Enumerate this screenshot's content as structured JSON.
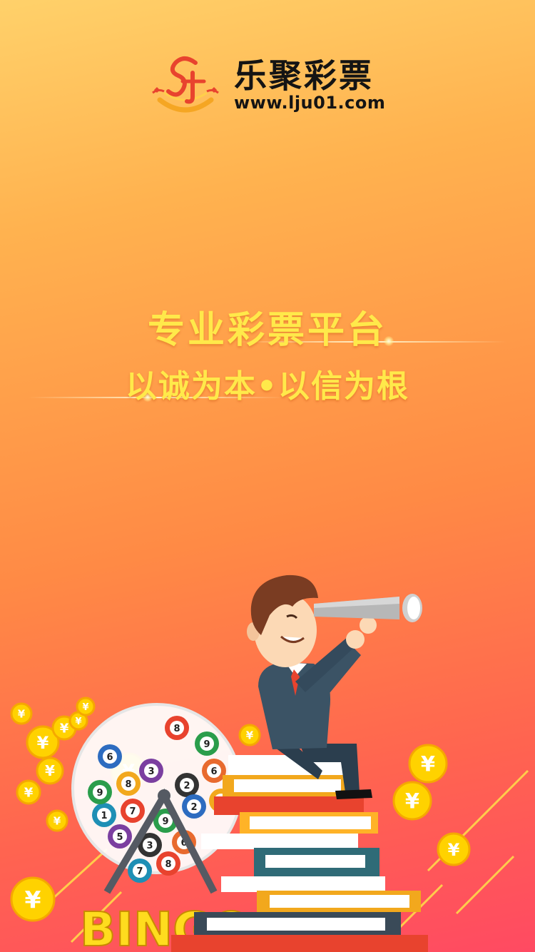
{
  "brand": {
    "name": "乐聚彩票",
    "url": "www.lju01.com"
  },
  "slogan": {
    "main": "专业彩票平台",
    "sub": "以诚为本•以信为根"
  },
  "illustration": {
    "sign_text": "BINGO",
    "ball_numbers": [
      "8",
      "9",
      "6",
      "8",
      "3",
      "2",
      "6",
      "1",
      "7",
      "9",
      "2",
      "1",
      "5",
      "3",
      "6",
      "7",
      "8",
      "9"
    ],
    "coin_symbol": "¥"
  },
  "colors": {
    "bg_top": "#ffd16a",
    "bg_bottom": "#ff4a62",
    "slogan": "#ffe94a",
    "brand_text": "#141414",
    "logo_red": "#e8432e",
    "coin_gold": "#ffd200"
  }
}
